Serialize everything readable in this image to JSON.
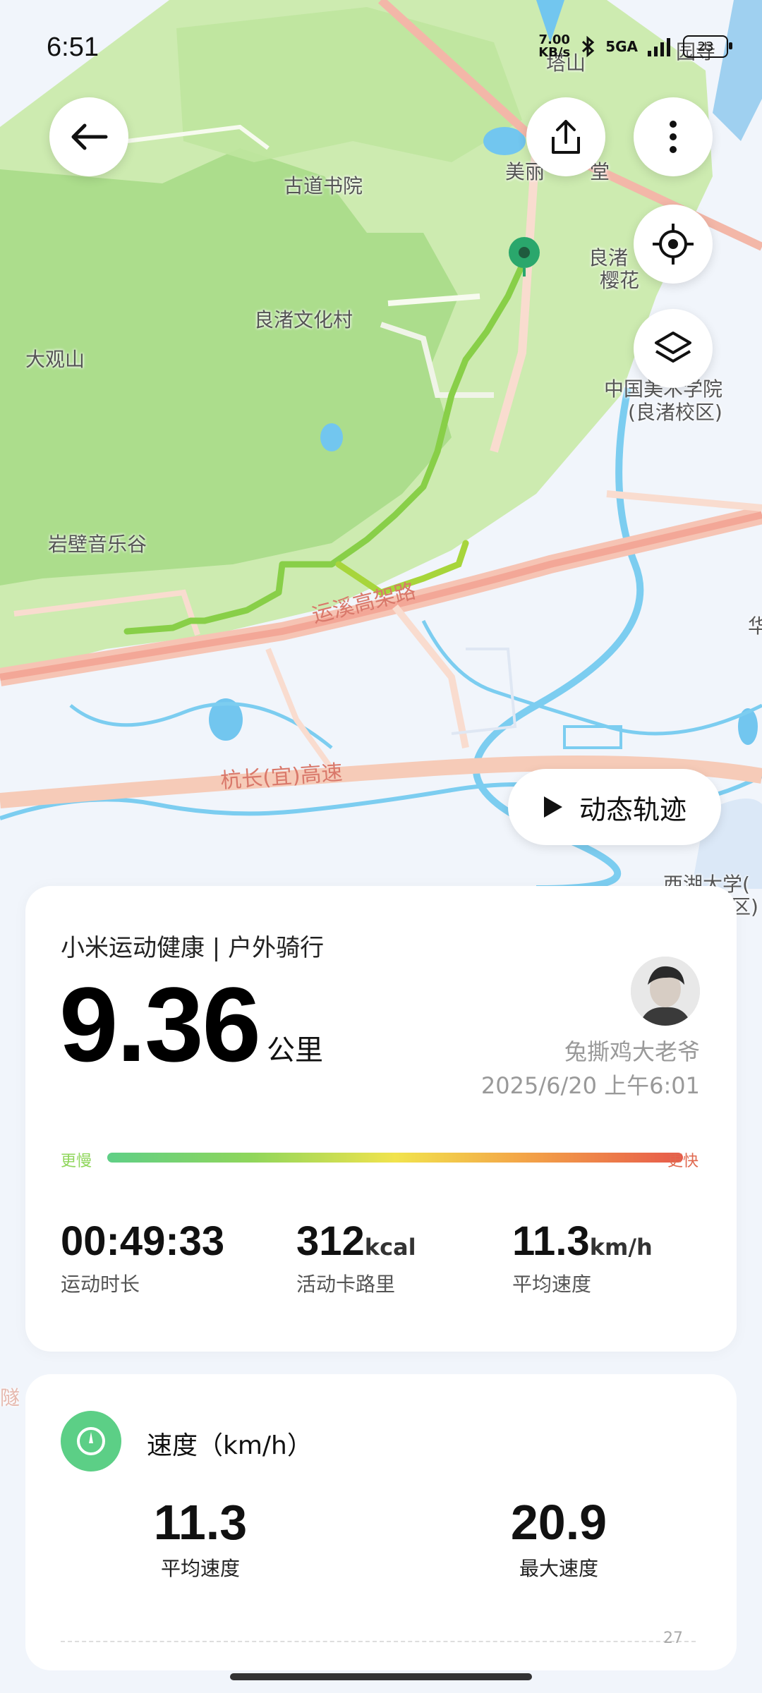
{
  "status_bar": {
    "time": "6:51",
    "net_speed_value": "7.00",
    "net_speed_unit": "KB/s",
    "network_gen": "5GA",
    "battery": "23"
  },
  "map": {
    "labels": [
      {
        "id": "gudao",
        "text": "古道书院"
      },
      {
        "id": "liangzhu-village",
        "text": "良渚文化村"
      },
      {
        "id": "daguanshan",
        "text": "大观山"
      },
      {
        "id": "yanbi",
        "text": "岩壁音乐谷"
      },
      {
        "id": "meili",
        "text": "美丽"
      },
      {
        "id": "meili2",
        "text": "堂"
      },
      {
        "id": "yinghua1",
        "text": "良渚"
      },
      {
        "id": "yinghua2",
        "text": "樱花"
      },
      {
        "id": "academy1",
        "text": "中国美术学院"
      },
      {
        "id": "academy2",
        "text": "(良渚校区)"
      },
      {
        "id": "xihu1",
        "text": "西湖大学("
      },
      {
        "id": "xihu2",
        "text": "区)"
      },
      {
        "id": "top1",
        "text": "塔山"
      },
      {
        "id": "top2",
        "text": "园寺"
      },
      {
        "id": "edge-hua",
        "text": "华"
      },
      {
        "id": "edge-sui",
        "text": "隧"
      }
    ],
    "roads": {
      "yunxi": "运溪高架路",
      "hangchang": "杭长(宜)高速"
    },
    "replay_label": "动态轨迹"
  },
  "summary": {
    "app_title": "小米运动健康 | 户外骑行",
    "distance": "9.36",
    "distance_unit": "公里",
    "user_name": "兔撕鸡大老爷",
    "date": "2025/6/20 上午6:01",
    "slower_label": "更慢",
    "faster_label": "更快",
    "stats": [
      {
        "value": "00:49:33",
        "unit": "",
        "label": "运动时长"
      },
      {
        "value": "312",
        "unit": "kcal",
        "label": "活动卡路里"
      },
      {
        "value": "11.3",
        "unit": "km/h",
        "label": "平均速度"
      }
    ]
  },
  "speed_card": {
    "title": "速度（km/h）",
    "avg_value": "11.3",
    "avg_label": "平均速度",
    "max_value": "20.9",
    "max_label": "最大速度",
    "axis_tick": "27"
  },
  "colors": {
    "accent_green": "#5ccf86",
    "route_green": "#8ed24a",
    "slower": "#8fd65b",
    "faster": "#e0694f"
  }
}
